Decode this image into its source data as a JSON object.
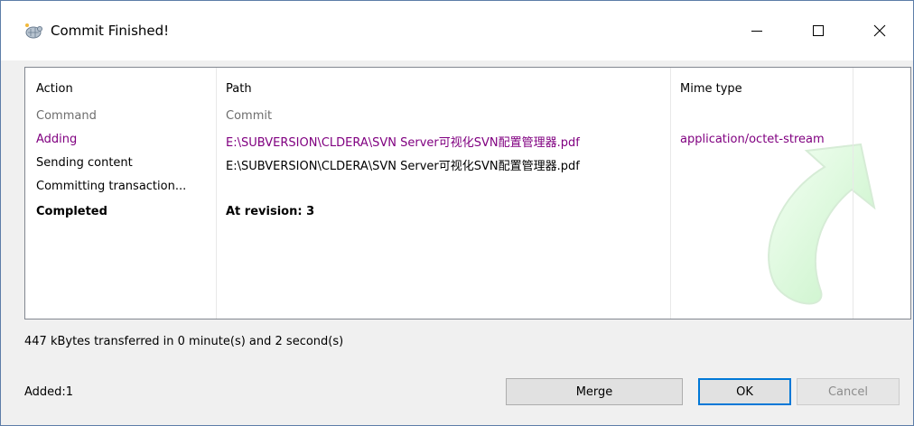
{
  "window": {
    "title": "Commit Finished!",
    "icon": "tortoise-svn-icon",
    "controls": {
      "minimize": "minimize-icon",
      "maximize": "maximize-icon",
      "close": "close-icon"
    }
  },
  "list": {
    "columns": [
      "Action",
      "Path",
      "Mime type"
    ],
    "rows": [
      {
        "action": "Command",
        "path": "Commit",
        "mime": "",
        "style": "gray"
      },
      {
        "action": "Adding",
        "path": "E:\\SUBVERSION\\CLDERA\\SVN Server可视化SVN配置管理器.pdf",
        "mime": "application/octet-stream",
        "style": "purple"
      },
      {
        "action": "Sending content",
        "path": "E:\\SUBVERSION\\CLDERA\\SVN Server可视化SVN配置管理器.pdf",
        "mime": "",
        "style": "black"
      },
      {
        "action": "Committing transaction...",
        "path": "",
        "mime": "",
        "style": "black"
      },
      {
        "action": "Completed",
        "path": "At revision: 3",
        "mime": "",
        "style": "bold"
      }
    ]
  },
  "status": {
    "transfer": "447 kBytes transferred in 0 minute(s) and 2 second(s)",
    "added": "Added:1"
  },
  "buttons": {
    "merge": "Merge",
    "ok": "OK",
    "cancel": "Cancel"
  },
  "colors": {
    "command": "#6d6d6d",
    "adding": "#800080",
    "accent": "#0078d7"
  }
}
